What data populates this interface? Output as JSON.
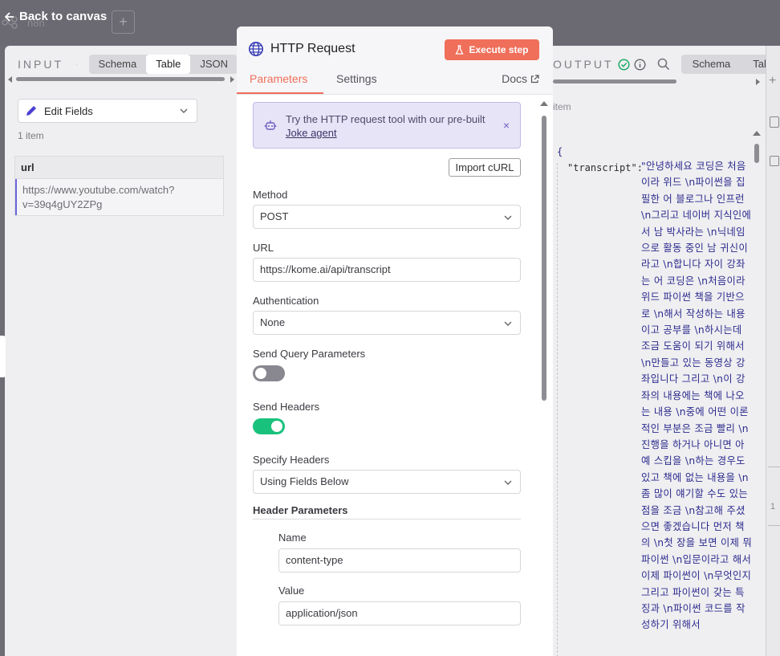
{
  "topbar": {
    "back_label": "Back to canvas",
    "plus_label": "+",
    "bg_text": "n8n"
  },
  "input_panel": {
    "label": "INPUT",
    "tabs": [
      "Schema",
      "Table",
      "JSON"
    ],
    "active_tab": "Table",
    "node_select": "Edit Fields",
    "item_count": "1 item",
    "table": {
      "columns": [
        "url"
      ],
      "rows": [
        [
          "https://www.youtube.com/watch?v=39q4gUY2ZPg"
        ]
      ]
    }
  },
  "node": {
    "title": "HTTP Request",
    "execute_label": "Execute step",
    "tabs": {
      "parameters": "Parameters",
      "settings": "Settings",
      "docs": "Docs"
    },
    "callout": {
      "text": "Try the HTTP request tool with our pre-built",
      "link": "Joke agent",
      "close": "×"
    },
    "import_label": "Import cURL",
    "method": {
      "label": "Method",
      "value": "POST"
    },
    "url": {
      "label": "URL",
      "value": "https://kome.ai/api/transcript"
    },
    "auth": {
      "label": "Authentication",
      "value": "None"
    },
    "send_query": {
      "label": "Send Query Parameters",
      "enabled": false
    },
    "send_headers": {
      "label": "Send Headers",
      "enabled": true
    },
    "specify_headers": {
      "label": "Specify Headers",
      "value": "Using Fields Below"
    },
    "header_params": {
      "title": "Header Parameters",
      "name_label": "Name",
      "name_value": "content-type",
      "value_label": "Value",
      "value_value": "application/json"
    }
  },
  "output_panel": {
    "label": "OUTPUT",
    "tabs": [
      "Schema",
      "Table"
    ],
    "items_text": "item",
    "json_open": "{",
    "json_key": "\"transcript\":",
    "json_value": "\"안녕하세요 코딩은 처음이라 위드 \\n파이썬을 집필한 어 블로그나 인프런 \\n그리고 네이버 지식인에서 남 박사라는 \\n닉네임으로 활동 중인 남 귀신이라고 \\n합니다 자이 강좌는 어 코딩은 \\n처음이라 위드 파이썬 책을 기반으로 \\n해서 작성하는 내용이고 공부를 \\n하시는데 조금 도움이 되기 위해서 \\n만들고 있는 동영상 강좌입니다 그리고 \\n이 강좌의 내용에는 책에 나오는 내용 \\n중에 어떤 이론적인 부분은 조금 빨리 \\n진행을 하거나 아니면 아예 스킵을 \\n하는 경우도 있고 책에 없는 내용을 \\n좀 많이 얘기할 수도 있는 점을 조금 \\n참고해 주셨으면 좋겠습니다 먼저 책의 \\n첫 장을 보면 이제 뭐 파이썬 \\n입문이라고 해서 이제 파이썬이 \\n무엇인지 그리고 파이썬이 갖는 특징과 \\n파이썬 코드를 작성하기 위해서"
  },
  "right_strip": {
    "plus": "+",
    "num": "1"
  },
  "colors": {
    "accent": "#ef6f5a",
    "toggle_on": "#19c27c",
    "callout_bg": "#e8e4f7"
  }
}
